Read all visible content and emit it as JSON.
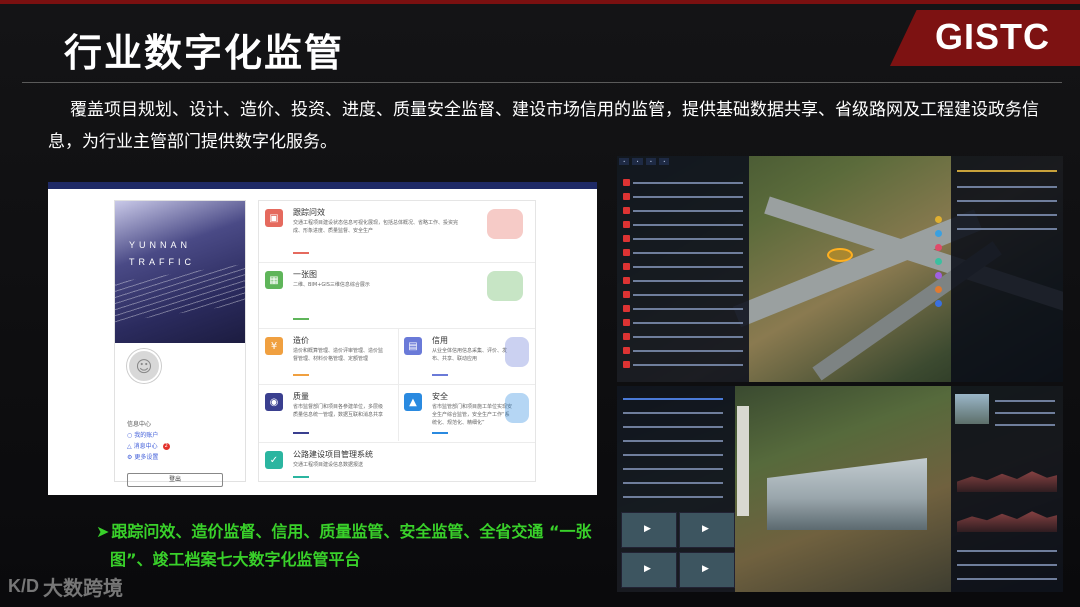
{
  "slide": {
    "title": "行业数字化监管",
    "logo": "GISTC",
    "description": "覆盖项目规划、设计、造价、投资、进度、质量安全监督、建设市场信用的监管，提供基础数据共享、省级路网及工程建设政务信息，为行业主管部门提供数字化服务。",
    "bullet_line1": "跟踪问效、造价监督、信用、质量监管、安全监管、全省交通 “一张",
    "bullet_line2": "图”、竣工档案七大数字化监管平台",
    "watermark": "大数跨境",
    "watermark_mark": "K/D"
  },
  "left_panel": {
    "banner_line1": "YUNNAN",
    "banner_line2": "TRAFFIC",
    "menu": {
      "item1": "信息中心",
      "item2": "我的账户",
      "item3": "消息中心",
      "item3_badge": "2",
      "item4": "更多设置"
    },
    "logout": "登出",
    "modules": [
      {
        "title": "跟踪问效",
        "desc": "交通工程项目建设状态信息可视化展现，包括总体概况、省略工作、投资完成、形象进度、质量监督、安全生产"
      },
      {
        "title": "一张图",
        "desc": "二维、BIM+GIS三维信息综合展示"
      },
      {
        "title": "造价",
        "desc": "造价和概算管理、造价评审管理、造价监督管理、材料价格管理、定额管理"
      },
      {
        "title": "信用",
        "desc": "从业全体信用信息采集、评价、发布、共享、联动应用"
      },
      {
        "title": "质量",
        "desc": "省市监督部门和项目各参建单位，多层级质量信息统一管理，数据互联和消息共享"
      },
      {
        "title": "安全",
        "desc": "省市监管部门和项目施工单位实现安全生产综合监管，安全生产工作“系统化、规范化、精细化”"
      },
      {
        "title": "公路建设项目管理系统",
        "desc": "交通工程项目建设信息数据报送"
      }
    ]
  },
  "colors": {
    "accent_red": "#7d1212",
    "bullet_green": "#39d12a"
  }
}
